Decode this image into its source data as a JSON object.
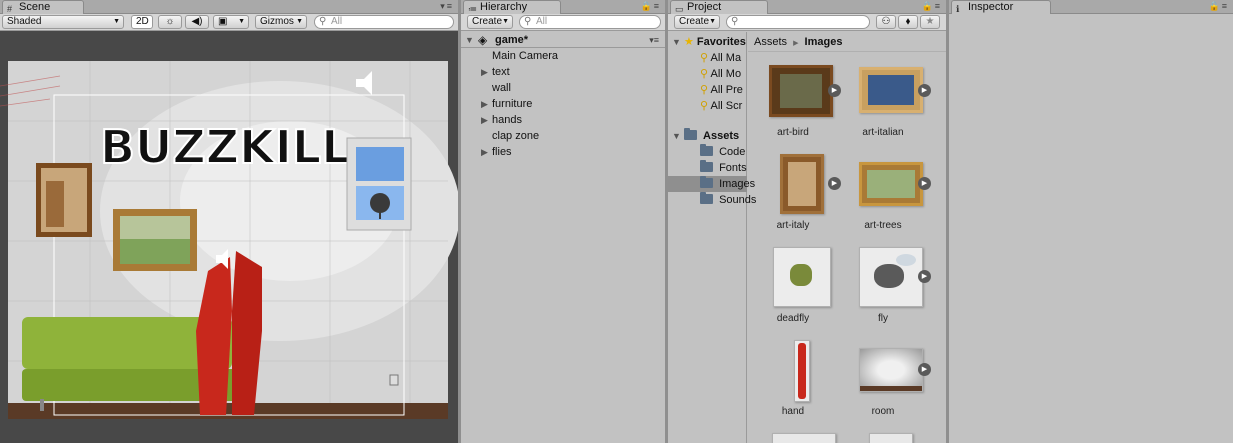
{
  "scene": {
    "tab": "Scene",
    "shading_mode": "Shaded",
    "mode_2d": "2D",
    "gizmos": "Gizmos",
    "search_placeholder": "All",
    "game_title_art": "BUZZKILL"
  },
  "hierarchy": {
    "tab": "Hierarchy",
    "create": "Create",
    "search_placeholder": "All",
    "root": "game*",
    "items": [
      {
        "label": "Main Camera",
        "has_children": false
      },
      {
        "label": "text",
        "has_children": true
      },
      {
        "label": "wall",
        "has_children": false
      },
      {
        "label": "furniture",
        "has_children": true
      },
      {
        "label": "hands",
        "has_children": true
      },
      {
        "label": "clap zone",
        "has_children": false
      },
      {
        "label": "flies",
        "has_children": true
      }
    ]
  },
  "project": {
    "tab": "Project",
    "create": "Create",
    "favorites_label": "Favorites",
    "favorites": [
      "All Ma",
      "All Mo",
      "All Pre",
      "All Scr"
    ],
    "assets_label": "Assets",
    "folders": [
      "Code",
      "Fonts",
      "Images",
      "Sounds"
    ],
    "selected_folder": "Images",
    "breadcrumb": [
      "Assets",
      "Images"
    ],
    "assets": [
      {
        "label": "art-bird"
      },
      {
        "label": "art-italian"
      },
      {
        "label": "art-italy"
      },
      {
        "label": "art-trees"
      },
      {
        "label": "deadfly"
      },
      {
        "label": "fly"
      },
      {
        "label": "hand"
      },
      {
        "label": "room"
      }
    ]
  },
  "inspector": {
    "tab": "Inspector"
  },
  "colors": {
    "panel_bg": "#c2c2c2",
    "selection": "#8f8f8f",
    "scene_bg": "#484848",
    "couch_green": "#8fb33a",
    "hand_red": "#c8281c",
    "floor_brown": "#5a3a26"
  }
}
